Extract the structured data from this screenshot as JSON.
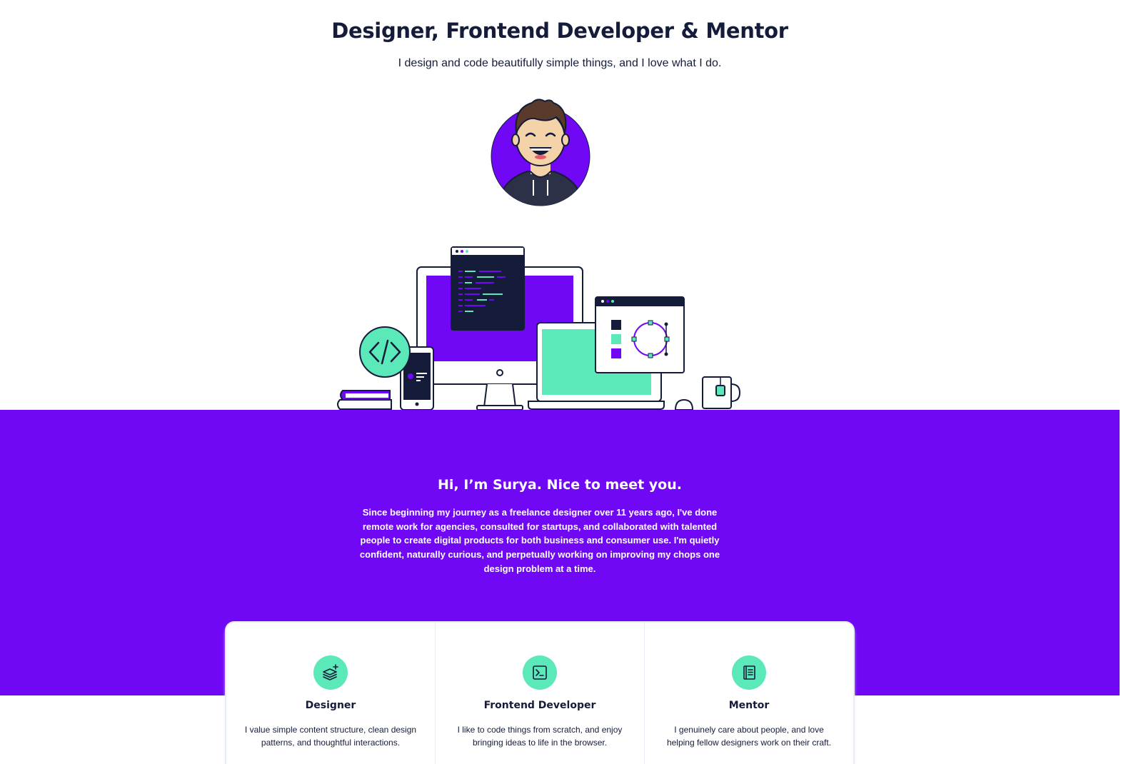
{
  "hero": {
    "title": "Designer, Frontend Developer & Mentor",
    "subtitle": "I design and code beautifully simple things, and I love what I do."
  },
  "about": {
    "title": "Hi, I’m Surya. Nice to meet you.",
    "text": "Since beginning my journey as a freelance designer over 11 years ago, I've done remote work for agencies, consulted for startups, and collaborated with talented people to create digital products for both business and consumer use. I'm quietly confident, naturally curious, and perpetually working on improving my chops one design problem at a time."
  },
  "cards": [
    {
      "icon": "layers-plus-icon",
      "title": "Designer",
      "text": "I value simple content structure, clean design patterns, and thoughtful interactions."
    },
    {
      "icon": "terminal-icon",
      "title": "Frontend Developer",
      "text": "I like to code things from scratch, and enjoy bringing ideas to life in the browser."
    },
    {
      "icon": "book-icon",
      "title": "Mentor",
      "text": "I genuinely care about people, and love helping fellow designers work on their craft."
    }
  ],
  "colors": {
    "primary": "#7108f5",
    "accent": "#5be9b9",
    "dark": "#141c3a",
    "background": "#ffffff"
  },
  "icons": {
    "code_badge": "code-brackets-icon",
    "avatar": "avatar"
  }
}
